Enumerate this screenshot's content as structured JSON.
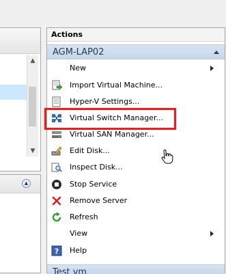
{
  "actions_pane": {
    "title": "Actions",
    "section": "AGM-LAP02",
    "items": [
      {
        "label": "New",
        "icon": "new-blank",
        "submenu": true
      },
      {
        "label": "Import Virtual Machine...",
        "icon": "import-vm-icon"
      },
      {
        "label": "Hyper-V Settings...",
        "icon": "settings-page-icon"
      },
      {
        "label": "Virtual Switch Manager...",
        "icon": "network-switch-icon"
      },
      {
        "label": "Virtual SAN Manager...",
        "icon": "san-icon"
      },
      {
        "label": "Edit Disk...",
        "icon": "edit-disk-icon"
      },
      {
        "label": "Inspect Disk...",
        "icon": "inspect-disk-icon"
      },
      {
        "label": "Stop Service",
        "icon": "stop-icon"
      },
      {
        "label": "Remove Server",
        "icon": "remove-x-icon"
      },
      {
        "label": "Refresh",
        "icon": "refresh-icon"
      },
      {
        "label": "View",
        "icon": "none",
        "submenu": true
      },
      {
        "label": "Help",
        "icon": "help-icon"
      }
    ],
    "next_section": "Test vm"
  },
  "colors": {
    "highlight_border": "#e42021",
    "section_header": "#c6d6ea",
    "selected_row": "#cce8ff"
  }
}
